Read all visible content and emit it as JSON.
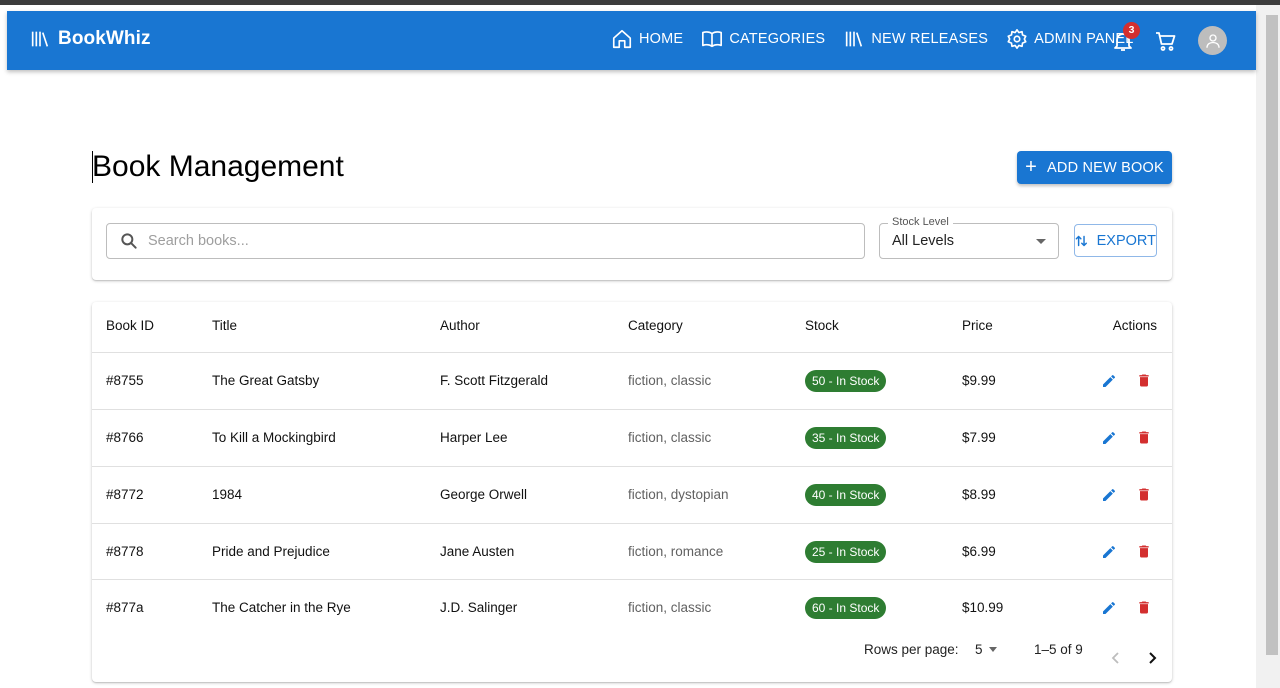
{
  "app": {
    "brand": "BookWhiz",
    "nav": [
      {
        "label": "HOME",
        "icon": "home-icon"
      },
      {
        "label": "CATEGORIES",
        "icon": "book-open-icon"
      },
      {
        "label": "NEW RELEASES",
        "icon": "library-icon"
      },
      {
        "label": "ADMIN PANEL",
        "icon": "gear-icon"
      }
    ],
    "notifications_count": "3",
    "colors": {
      "primary": "#1976d2",
      "stock": "#2e7d32",
      "delete": "#d32f2f",
      "badge": "#d32f2f"
    }
  },
  "page": {
    "title": "Book Management",
    "add_button": "ADD NEW BOOK"
  },
  "filters": {
    "search_placeholder": "Search books...",
    "stock_level_label": "Stock Level",
    "stock_level_value": "All Levels",
    "export_label": "EXPORT"
  },
  "table": {
    "headers": [
      "Book ID",
      "Title",
      "Author",
      "Category",
      "Stock",
      "Price",
      "Actions"
    ],
    "rows": [
      {
        "id": "#8755",
        "title": "The Great Gatsby",
        "author": "F. Scott Fitzgerald",
        "category": "fiction, classic",
        "stock": "50 - In Stock",
        "price": "$9.99"
      },
      {
        "id": "#8766",
        "title": "To Kill a Mockingbird",
        "author": "Harper Lee",
        "category": "fiction, classic",
        "stock": "35 - In Stock",
        "price": "$7.99"
      },
      {
        "id": "#8772",
        "title": "1984",
        "author": "George Orwell",
        "category": "fiction, dystopian",
        "stock": "40 - In Stock",
        "price": "$8.99"
      },
      {
        "id": "#8778",
        "title": "Pride and Prejudice",
        "author": "Jane Austen",
        "category": "fiction, romance",
        "stock": "25 - In Stock",
        "price": "$6.99"
      },
      {
        "id": "#877a",
        "title": "The Catcher in the Rye",
        "author": "J.D. Salinger",
        "category": "fiction, classic",
        "stock": "60 - In Stock",
        "price": "$10.99"
      }
    ]
  },
  "pagination": {
    "rows_per_page_label": "Rows per page:",
    "rows_per_page_value": "5",
    "range": "1–5 of 9"
  }
}
